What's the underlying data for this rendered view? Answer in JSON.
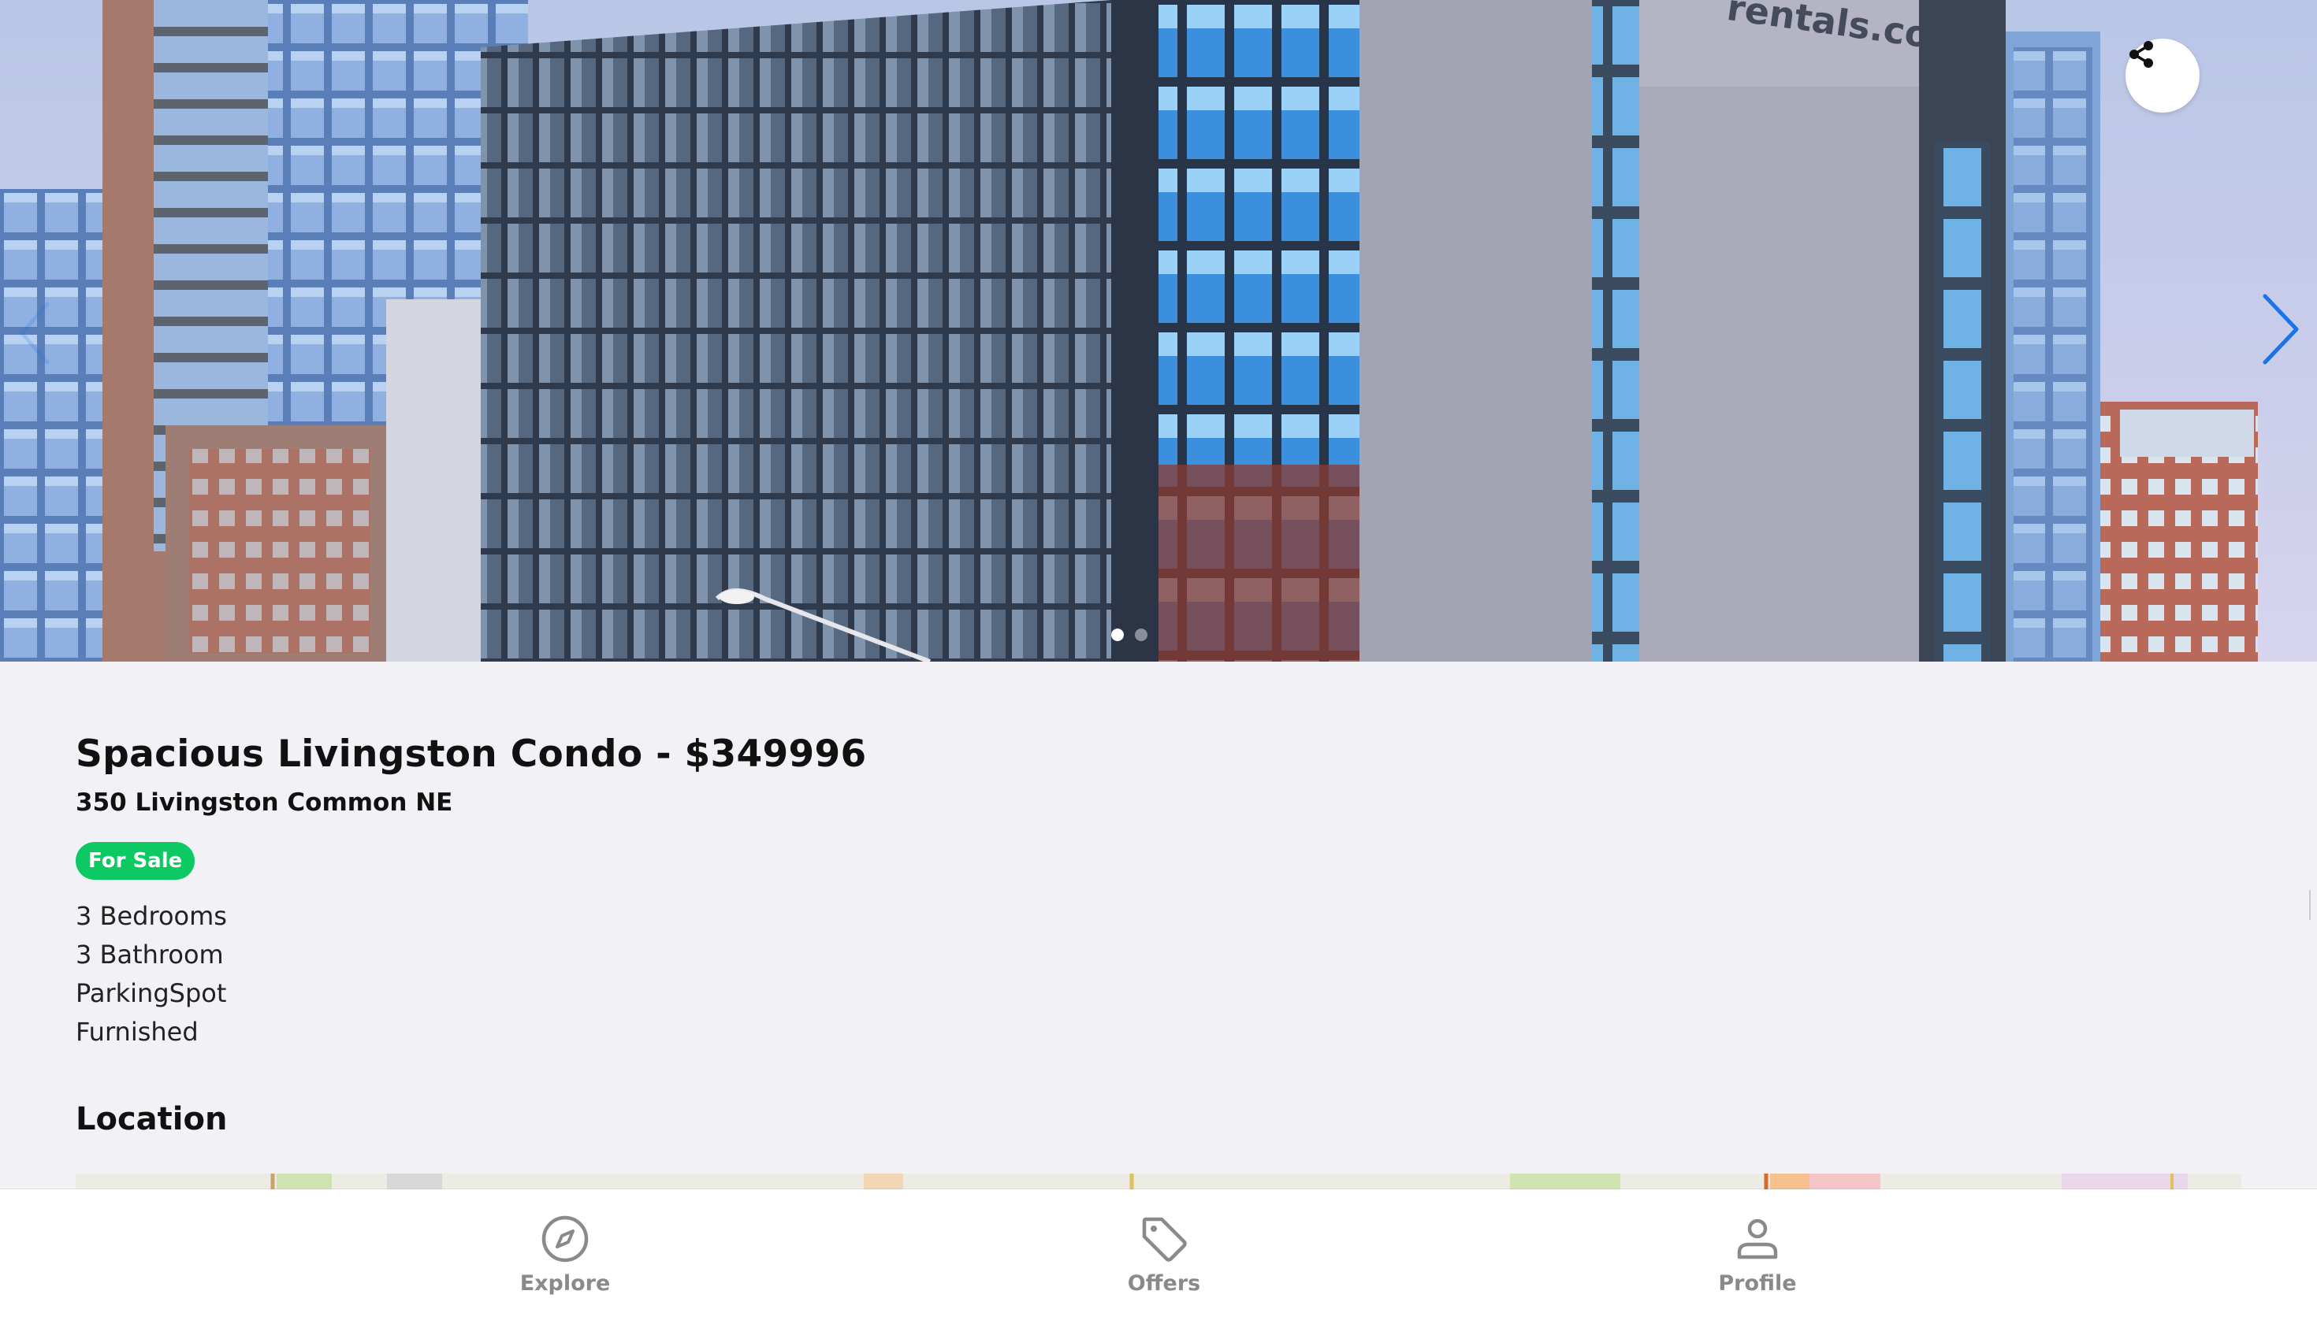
{
  "listing": {
    "title": "Spacious Livingston Condo - $349996",
    "address": "350 Livingston Common NE",
    "status_badge": "For Sale",
    "features": [
      "3 Bedrooms",
      "3 Bathroom",
      "ParkingSpot",
      "Furnished"
    ],
    "status_color": "#0dc963"
  },
  "gallery": {
    "image_count": 2,
    "active_index": 0,
    "sign_text": "rentals.com",
    "icons": {
      "share": "share-icon",
      "next": "chevron-right-icon",
      "prev": "chevron-left-icon"
    },
    "arrow_color": "#1a73e8"
  },
  "location": {
    "section_title": "Location"
  },
  "bottom_nav": {
    "items": [
      {
        "label": "Explore",
        "icon": "compass-icon"
      },
      {
        "label": "Offers",
        "icon": "tag-icon"
      },
      {
        "label": "Profile",
        "icon": "person-icon"
      }
    ],
    "inactive_color": "#8a8a8a"
  }
}
